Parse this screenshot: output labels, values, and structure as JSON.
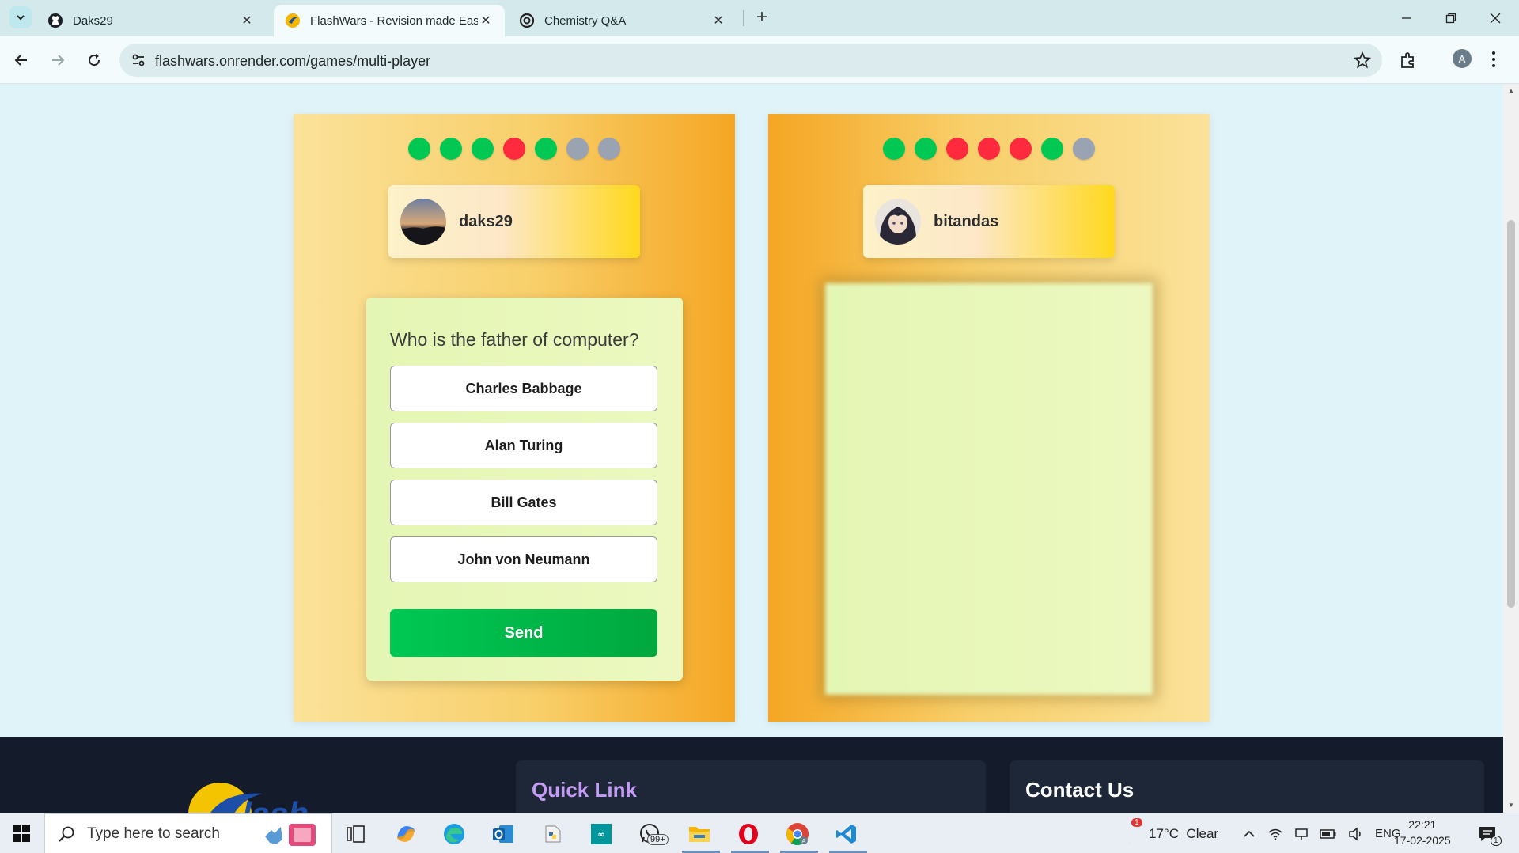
{
  "browser": {
    "tabs": [
      {
        "title": "Daks29",
        "icon": "github-icon",
        "active": false
      },
      {
        "title": "FlashWars - Revision made Easy",
        "icon": "flashwars-icon",
        "active": true
      },
      {
        "title": "Chemistry Q&A",
        "icon": "openai-icon",
        "active": false
      }
    ],
    "url": "flashwars.onrender.com/games/multi-player",
    "profile_initial": "A"
  },
  "game": {
    "colors": {
      "correct": "#00c853",
      "wrong": "#ff2a3d",
      "pending": "#9aa3b2"
    },
    "left_player": {
      "name": "daks29",
      "results": [
        "correct",
        "correct",
        "correct",
        "wrong",
        "correct",
        "pending",
        "pending"
      ]
    },
    "right_player": {
      "name": "bitandas",
      "results": [
        "correct",
        "correct",
        "wrong",
        "wrong",
        "wrong",
        "correct",
        "pending"
      ]
    },
    "question": "Who is the father of computer?",
    "options": [
      "Charles Babbage",
      "Alan Turing",
      "Bill Gates",
      "John von Neumann"
    ],
    "send_label": "Send"
  },
  "footer": {
    "quick_link_title": "Quick Link",
    "contact_title": "Contact Us"
  },
  "taskbar": {
    "search_placeholder": "Type here to search",
    "notification_count": "99+",
    "weather_badge": "1",
    "weather": "17°C  Clear",
    "language": "ENG",
    "time": "22:21",
    "date": "17-02-2025",
    "action_center_count": "1"
  }
}
